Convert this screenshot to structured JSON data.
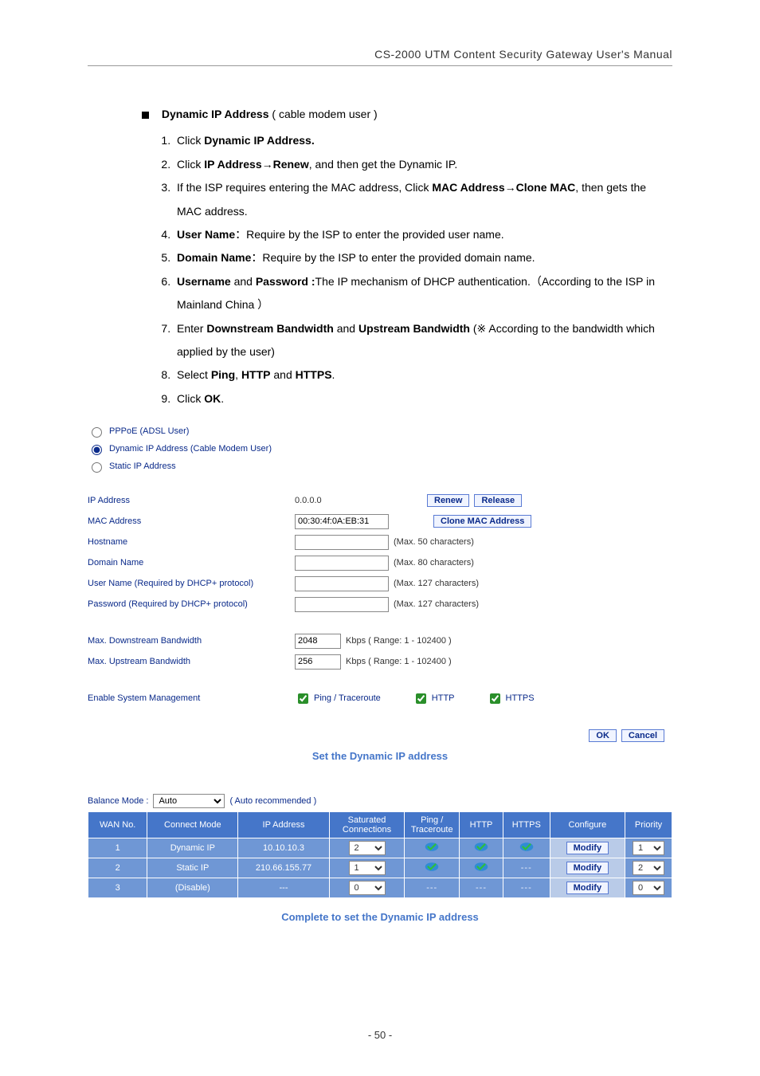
{
  "header": {
    "title": "CS-2000 UTM Content Security Gateway User's Manual"
  },
  "instructions": {
    "heading_bold": "Dynamic IP Address",
    "heading_rest": " ( cable modem user )",
    "items": [
      {
        "prefix": "Click ",
        "bold1": "Dynamic IP Address."
      },
      {
        "prefix": "Click ",
        "bold1": "IP Address",
        "arrow": true,
        "bold2": "Renew",
        "suffix": ", and then get the Dynamic IP."
      },
      {
        "prefix": "If the ISP requires entering the MAC address, Click ",
        "bold1": "MAC Address",
        "arrow": true,
        "bold2": "Clone MAC",
        "suffix": ", then gets the MAC address."
      },
      {
        "bold1": "User Name",
        "colon": "：",
        "suffix": "Require by the ISP to enter the provided user name."
      },
      {
        "bold1": "Domain Name",
        "colon": "：",
        "suffix": "Require by the ISP to enter the provided domain name."
      },
      {
        "bold1": "Username",
        "mid": " and ",
        "bold2": "Password :",
        "suffix": "The IP mechanism of DHCP authentication.（According to the ISP in Mainland China ）"
      },
      {
        "prefix": "Enter ",
        "bold1": "Downstream Bandwidth",
        "mid": " and ",
        "bold2": "Upstream Bandwidth",
        "suffix": " (※ According to the bandwidth which applied by the user)"
      },
      {
        "prefix": "Select ",
        "bold1": "Ping",
        "mid": ", ",
        "bold2": "HTTP",
        "mid2": " and ",
        "bold3": "HTTPS",
        "suffix": "."
      },
      {
        "prefix": "Click ",
        "bold1": "OK",
        "suffix": "."
      }
    ]
  },
  "radios": {
    "pppoe": "PPPoE (ADSL User)",
    "dynamic": "Dynamic IP Address (Cable Modem User)",
    "static": "Static IP Address"
  },
  "form": {
    "ip_label": "IP Address",
    "ip_value": "0.0.0.0",
    "renew_btn": "Renew",
    "release_btn": "Release",
    "mac_label": "MAC Address",
    "mac_value": "00:30:4f:0A:EB:31",
    "clone_btn": "Clone MAC Address",
    "host_label": "Hostname",
    "host_hint": "(Max. 50 characters)",
    "domain_label": "Domain Name",
    "domain_hint": "(Max. 80 characters)",
    "user_label": "User Name (Required by DHCP+ protocol)",
    "user_hint": "(Max. 127 characters)",
    "pass_label": "Password (Required by DHCP+ protocol)",
    "pass_hint": "(Max. 127 characters)",
    "down_label": "Max. Downstream Bandwidth",
    "down_value": "2048",
    "up_label": "Max. Upstream Bandwidth",
    "up_value": "256",
    "bw_hint": "Kbps  ( Range: 1 - 102400 )",
    "enable_label": "Enable System Management",
    "ping_label": "Ping / Traceroute",
    "http_label": "HTTP",
    "https_label": "HTTPS",
    "ok": "OK",
    "cancel": "Cancel"
  },
  "caption1": "Set the Dynamic IP address",
  "balance": {
    "mode_label": "Balance Mode :",
    "mode_value": "Auto",
    "mode_hint": "( Auto recommended )",
    "headers": {
      "wan_no": "WAN No.",
      "connect": "Connect Mode",
      "ip": "IP Address",
      "sat": "Saturated Connections",
      "ping": "Ping / Traceroute",
      "http": "HTTP",
      "https": "HTTPS",
      "cfg": "Configure",
      "prio": "Priority"
    },
    "rows": [
      {
        "no": "1",
        "connect": "Dynamic IP",
        "ip": "10.10.10.3",
        "sat": "2",
        "ping": true,
        "http": true,
        "https": true,
        "cfg": "Modify",
        "prio": "1"
      },
      {
        "no": "2",
        "connect": "Static IP",
        "ip": "210.66.155.77",
        "sat": "1",
        "ping": true,
        "http": true,
        "https": false,
        "cfg": "Modify",
        "prio": "2"
      },
      {
        "no": "3",
        "connect": "(Disable)",
        "ip": "---",
        "sat": "0",
        "ping": false,
        "http": false,
        "https": false,
        "cfg": "Modify",
        "prio": "0"
      }
    ]
  },
  "caption2": "Complete to set the Dynamic IP address",
  "footer": "- 50 -"
}
